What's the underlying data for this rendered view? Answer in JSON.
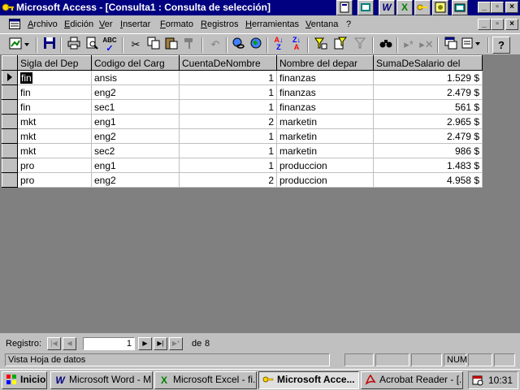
{
  "titlebar": {
    "title": "Microsoft Access - [Consulta1 : Consulta de selección]",
    "shortcut_icons": [
      "W",
      "X"
    ]
  },
  "menubar": {
    "items": [
      "Archivo",
      "Edición",
      "Ver",
      "Insertar",
      "Formato",
      "Registros",
      "Herramientas",
      "Ventana",
      "?"
    ]
  },
  "toolbar": {
    "buttons": [
      "view-icon",
      "save-icon",
      "print-icon",
      "print-preview-icon",
      "spelling-icon",
      "cut-icon",
      "copy-icon",
      "paste-icon",
      "format-painter-icon",
      "undo-icon",
      "hyperlink-icon",
      "web-toolbar-icon",
      "sort-ascending-icon",
      "sort-descending-icon",
      "filter-by-selection-icon",
      "filter-by-form-icon",
      "apply-filter-icon",
      "find-icon",
      "new-record-icon",
      "delete-record-icon",
      "database-window-icon",
      "new-object-icon",
      "help-icon"
    ]
  },
  "datasheet": {
    "columns": [
      "Sigla del Dep",
      "Codigo del Carg",
      "CuentaDeNombre",
      "Nombre del depar",
      "SumaDeSalario del"
    ],
    "rows": [
      [
        "fin",
        "ansis",
        "1",
        "finanzas",
        "1.529 $"
      ],
      [
        "fin",
        "eng2",
        "1",
        "finanzas",
        "2.479 $"
      ],
      [
        "fin",
        "sec1",
        "1",
        "finanzas",
        "561 $"
      ],
      [
        "mkt",
        "eng1",
        "2",
        "marketin",
        "2.965 $"
      ],
      [
        "mkt",
        "eng2",
        "1",
        "marketin",
        "2.479 $"
      ],
      [
        "mkt",
        "sec2",
        "1",
        "marketin",
        "986 $"
      ],
      [
        "pro",
        "eng1",
        "1",
        "produccion",
        "1.483 $"
      ],
      [
        "pro",
        "eng2",
        "2",
        "produccion",
        "4.958 $"
      ]
    ]
  },
  "recnav": {
    "label": "Registro:",
    "current": "1",
    "of_label": "de",
    "total": "8"
  },
  "statusbar": {
    "text": "Vista Hoja de datos",
    "num_indicator": "NUM"
  },
  "taskbar": {
    "start_label": "Inicio",
    "tasks": [
      "Microsoft Word - M...",
      "Microsoft Excel - fi...",
      "Microsoft Acce...",
      "Acrobat Reader - [..."
    ],
    "clock": "10:31"
  }
}
